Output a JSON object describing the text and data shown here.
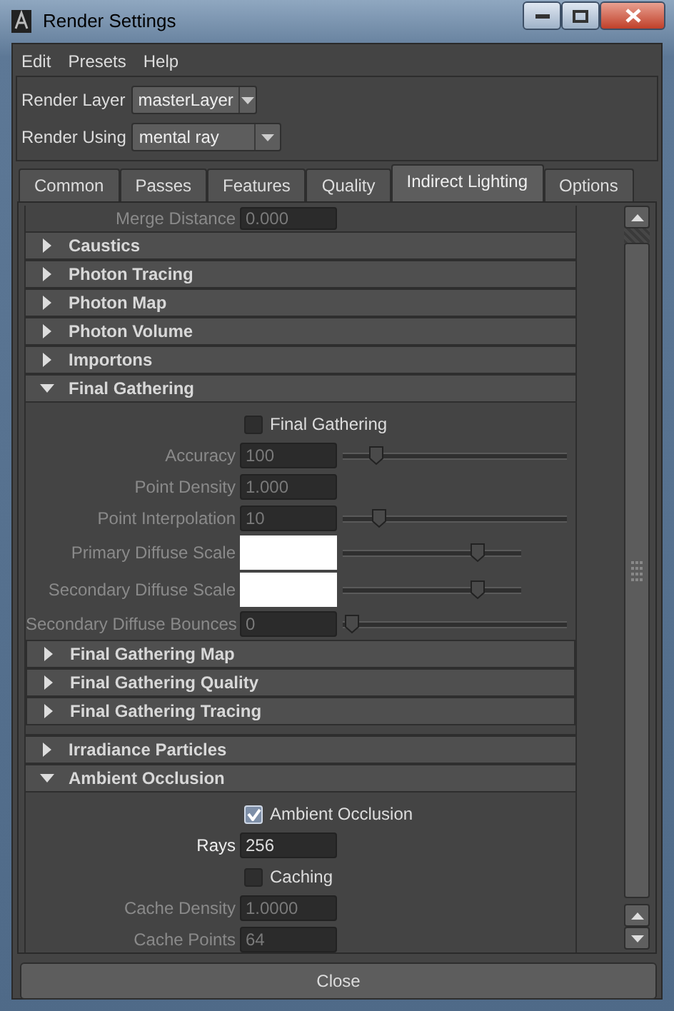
{
  "window": {
    "title": "Render Settings"
  },
  "menu": [
    "Edit",
    "Presets",
    "Help"
  ],
  "render_options": [
    {
      "label": "Render Layer",
      "value": "masterLayer"
    },
    {
      "label": "Render Using",
      "value": "mental ray"
    }
  ],
  "tabs": [
    {
      "label": "Common",
      "selected": false
    },
    {
      "label": "Passes",
      "selected": false
    },
    {
      "label": "Features",
      "selected": false
    },
    {
      "label": "Quality",
      "selected": false
    },
    {
      "label": "Indirect Lighting",
      "selected": true
    },
    {
      "label": "Options",
      "selected": false
    }
  ],
  "panel": {
    "partial_row": {
      "label": "Merge Distance",
      "value": "0.000"
    },
    "sections": [
      {
        "title": "Caustics",
        "expanded": false
      },
      {
        "title": "Photon Tracing",
        "expanded": false
      },
      {
        "title": "Photon Map",
        "expanded": false
      },
      {
        "title": "Photon Volume",
        "expanded": false
      },
      {
        "title": "Importons",
        "expanded": false
      },
      {
        "title": "Final Gathering",
        "expanded": true,
        "items": [
          {
            "kind": "checkbox",
            "label": "Final Gathering",
            "checked": false
          },
          {
            "kind": "field",
            "label": "Accuracy",
            "value": "100",
            "disabled": true,
            "level": 0.12
          },
          {
            "kind": "field",
            "label": "Point Density",
            "value": "1.000",
            "disabled": true
          },
          {
            "kind": "field",
            "label": "Point Interpolation",
            "value": "10",
            "disabled": true,
            "level": 0.13
          },
          {
            "kind": "color",
            "label": "Primary Diffuse Scale",
            "disabled": true,
            "level": 0.78
          },
          {
            "kind": "color",
            "label": "Secondary Diffuse Scale",
            "disabled": true,
            "level": 0.78
          },
          {
            "kind": "field",
            "label": "Secondary Diffuse Bounces",
            "value": "0",
            "disabled": true,
            "level": 0
          },
          {
            "kind": "section",
            "title": "Final Gathering Map",
            "expanded": false
          },
          {
            "kind": "section",
            "title": "Final Gathering Quality",
            "expanded": false
          },
          {
            "kind": "section",
            "title": "Final Gathering Tracing",
            "expanded": false
          }
        ]
      },
      {
        "title": "Irradiance Particles",
        "expanded": false
      },
      {
        "title": "Ambient Occlusion",
        "expanded": true,
        "items": [
          {
            "kind": "checkbox",
            "label": "Ambient Occlusion",
            "checked": true
          },
          {
            "kind": "field",
            "label": "Rays",
            "value": "256",
            "disabled": false
          },
          {
            "kind": "checkbox",
            "label": "Caching",
            "checked": false
          },
          {
            "kind": "field",
            "label": "Cache Density",
            "value": "1.0000",
            "disabled": true
          },
          {
            "kind": "field",
            "label": "Cache Points",
            "value": "64",
            "disabled": true
          }
        ]
      }
    ]
  },
  "close_button": "Close"
}
